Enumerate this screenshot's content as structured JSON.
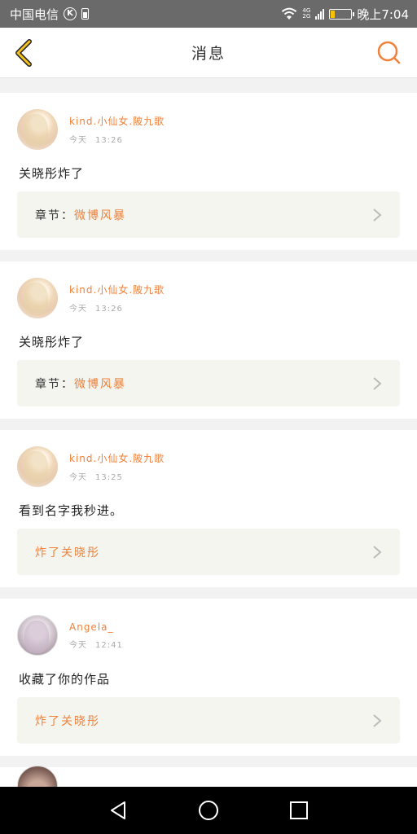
{
  "status_bar": {
    "carrier": "中国电信",
    "carrier_badge": "K",
    "network_top": "4G",
    "network_bottom": "2G",
    "time": "晚上7:04",
    "battery_level": 0.2,
    "icons": [
      "sim-icon",
      "wifi-icon",
      "signal-icon",
      "battery-icon"
    ]
  },
  "header": {
    "title": "消息",
    "back_icon": "chevron-left-icon",
    "search_icon": "search-icon",
    "accent_color": "#f0813a"
  },
  "messages": [
    {
      "username": "kind.小仙女.陂九歌",
      "time_label": "今天",
      "time": "13:26",
      "comment": "关晓彤炸了",
      "chapter_label": "章节：",
      "chapter_value": "微博风暴"
    },
    {
      "username": "kind.小仙女.陂九歌",
      "time_label": "今天",
      "time": "13:26",
      "comment": "关晓彤炸了",
      "chapter_label": "章节：",
      "chapter_value": "微博风暴"
    },
    {
      "username": "kind.小仙女.陂九歌",
      "time_label": "今天",
      "time": "13:25",
      "comment": "看到名字我秒进。",
      "chapter_label": "",
      "chapter_value": "炸了关晓彤"
    },
    {
      "username": "Angela_",
      "time_label": "今天",
      "time": "12:41",
      "comment": "收藏了你的作品",
      "chapter_label": "",
      "chapter_value": "炸了关晓彤"
    }
  ],
  "nav": {
    "back_icon": "triangle-back-icon",
    "home_icon": "circle-home-icon",
    "recents_icon": "square-recents-icon"
  }
}
